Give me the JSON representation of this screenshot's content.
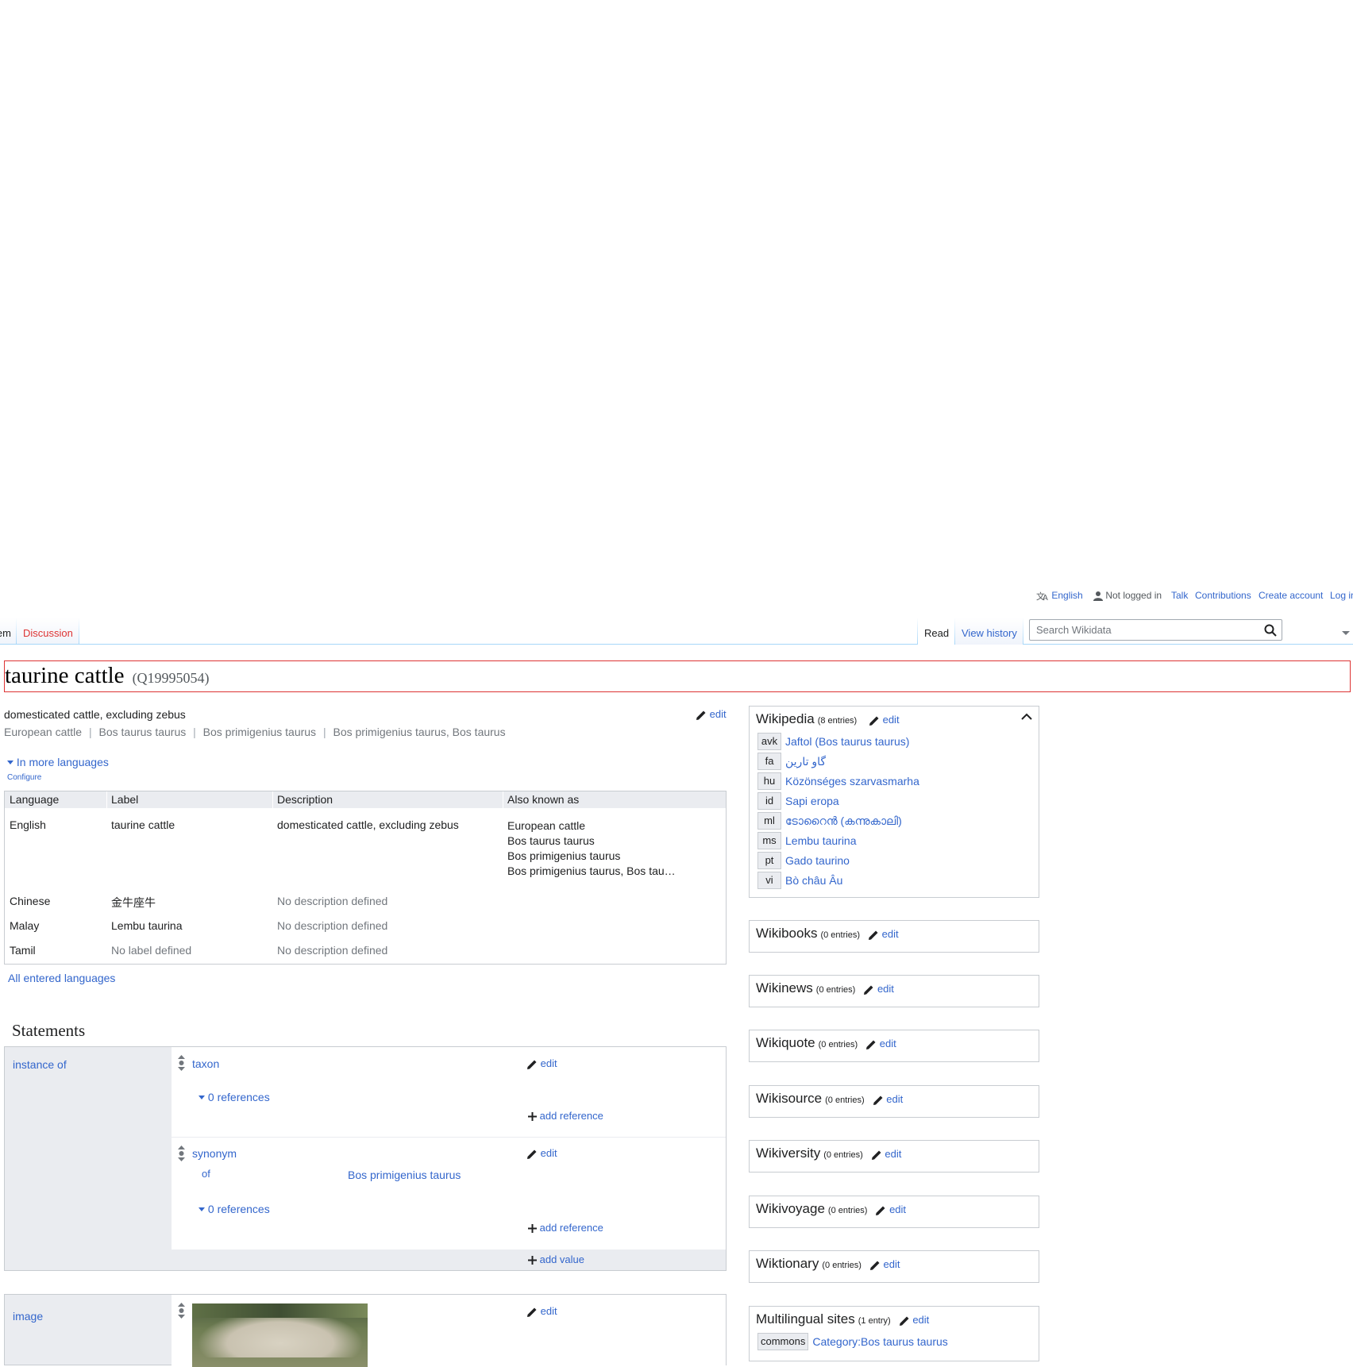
{
  "personal": {
    "language": "English",
    "not_logged_in": "Not logged in",
    "talk": "Talk",
    "contributions": "Contributions",
    "create_account": "Create account",
    "log_in": "Log in"
  },
  "tabs": {
    "item": "Item",
    "discussion": "Discussion",
    "read": "Read",
    "view_history": "View history"
  },
  "search": {
    "placeholder": "Search Wikidata"
  },
  "header": {
    "title": "taurine cattle",
    "qid": "(Q19995054)"
  },
  "terms": {
    "description": "domesticated cattle, excluding zebus",
    "aliases": [
      "European cattle",
      "Bos taurus taurus",
      "Bos primigenius taurus",
      "Bos primigenius taurus, Bos taurus"
    ],
    "edit": "edit",
    "more_languages": "In more languages",
    "configure": "Configure",
    "all_languages": "All entered languages",
    "columns": [
      "Language",
      "Label",
      "Description",
      "Also known as"
    ],
    "rows": [
      {
        "language": "English",
        "label": "taurine cattle",
        "description": "domesticated cattle, excluding zebus",
        "aliases": [
          "European cattle",
          "Bos taurus taurus",
          "Bos primigenius taurus",
          "Bos primigenius taurus, Bos tau…"
        ]
      },
      {
        "language": "Chinese",
        "label": "金牛座牛",
        "description": "No description defined"
      },
      {
        "language": "Malay",
        "label": "Lembu taurina",
        "description": "No description defined"
      },
      {
        "language": "Tamil",
        "label": "No label defined",
        "description": "No description defined"
      }
    ]
  },
  "statements": {
    "heading": "Statements",
    "edit": "edit",
    "add_reference": "add reference",
    "add_value": "add value",
    "instance_of": {
      "property": "instance of",
      "values": [
        {
          "value": "taxon",
          "references": "0 references"
        },
        {
          "value": "synonym",
          "qualifier_property": "of",
          "qualifier_value": "Bos primigenius taurus",
          "references": "0 references"
        }
      ]
    },
    "image": {
      "property": "image"
    }
  },
  "sitelinks": {
    "edit": "edit",
    "wikipedia": {
      "title": "Wikipedia",
      "count": "(8 entries)",
      "entries": [
        {
          "code": "avk",
          "title": "Jaftol (Bos taurus taurus)"
        },
        {
          "code": "fa",
          "title": "گاو تارین"
        },
        {
          "code": "hu",
          "title": "Közönséges szarvasmarha"
        },
        {
          "code": "id",
          "title": "Sapi eropa"
        },
        {
          "code": "ml",
          "title": "ടോറൈൻ (കന്നുകാലി)"
        },
        {
          "code": "ms",
          "title": "Lembu taurina"
        },
        {
          "code": "pt",
          "title": "Gado taurino"
        },
        {
          "code": "vi",
          "title": "Bò châu Âu"
        }
      ]
    },
    "groups": [
      {
        "title": "Wikibooks",
        "count": "(0 entries)"
      },
      {
        "title": "Wikinews",
        "count": "(0 entries)"
      },
      {
        "title": "Wikiquote",
        "count": "(0 entries)"
      },
      {
        "title": "Wikisource",
        "count": "(0 entries)"
      },
      {
        "title": "Wikiversity",
        "count": "(0 entries)"
      },
      {
        "title": "Wikivoyage",
        "count": "(0 entries)"
      },
      {
        "title": "Wiktionary",
        "count": "(0 entries)"
      }
    ],
    "multilingual": {
      "title": "Multilingual sites",
      "count": "(1 entry)",
      "entries": [
        {
          "code": "commons",
          "title": "Category:Bos taurus taurus"
        }
      ]
    }
  }
}
